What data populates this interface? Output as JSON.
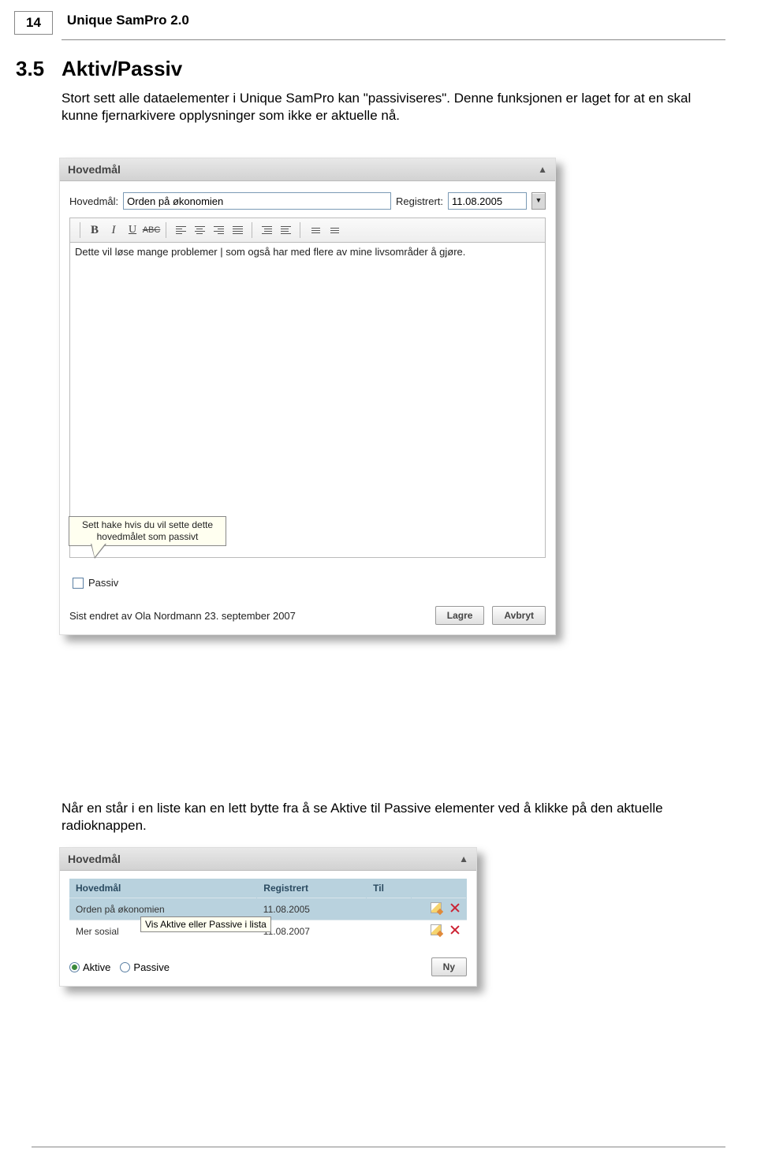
{
  "header": {
    "page_number": "14",
    "doc_title": "Unique SamPro 2.0"
  },
  "section": {
    "number": "3.5",
    "title": "Aktiv/Passiv"
  },
  "para1": "Stort sett alle dataelementer i Unique SamPro kan \"passiviseres\". Denne funksjonen er laget for at en skal kunne fjernarkivere opplysninger som ikke er aktuelle nå.",
  "panel1": {
    "title": "Hovedmål",
    "labels": {
      "hovedmal": "Hovedmål:",
      "registrert": "Registrert:"
    },
    "hovedmal_value": "Orden på økonomien",
    "registrert_value": "11.08.2005",
    "dd_glyph": "▼",
    "rt_text": "Dette vil løse mange problemer | som også har med flere av mine livsområder å gjøre.",
    "tooltip": "Sett hake hvis du vil sette dette hovedmålet som passivt",
    "passiv_label": "Passiv",
    "status": "Sist endret av Ola Nordmann 23. september 2007",
    "save": "Lagre",
    "cancel": "Avbryt",
    "tb": {
      "b": "B",
      "i": "I",
      "u": "U",
      "s": "ABC"
    }
  },
  "para2": "Når en står i en liste kan en lett bytte fra å se Aktive til Passive elementer ved å klikke på den aktuelle radioknappen.",
  "panel2": {
    "title": "Hovedmål",
    "cols": {
      "c1": "Hovedmål",
      "c2": "Registrert",
      "c3": "Til"
    },
    "rows": [
      {
        "c1": "Orden på økonomien",
        "c2": "11.08.2005",
        "c3": ""
      },
      {
        "c1": "Mer sosial",
        "c2": "11.08.2007",
        "c3": ""
      }
    ],
    "tooltip": "Vis Aktive eller Passive i lista",
    "radio_aktive": "Aktive",
    "radio_passive": "Passive",
    "ny": "Ny"
  }
}
